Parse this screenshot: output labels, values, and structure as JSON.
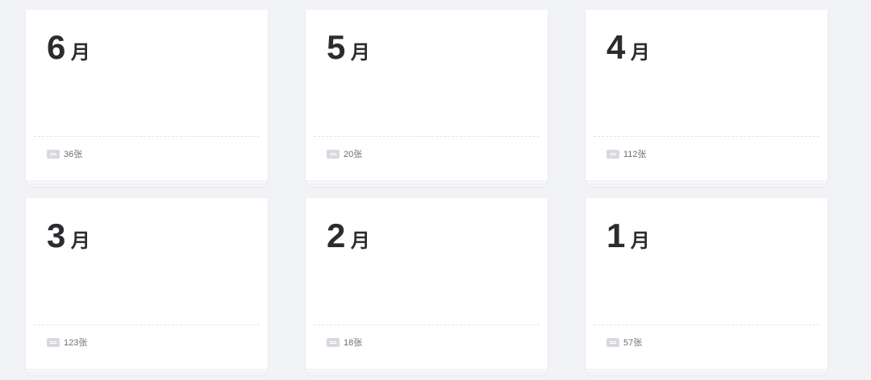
{
  "month_unit": "月",
  "cards": [
    {
      "month": "6",
      "count": "36张"
    },
    {
      "month": "5",
      "count": "20张"
    },
    {
      "month": "4",
      "count": "112张"
    },
    {
      "month": "3",
      "count": "123张"
    },
    {
      "month": "2",
      "count": "18张"
    },
    {
      "month": "1",
      "count": "57张"
    }
  ],
  "colors": {
    "background": "#f2f3f6",
    "card": "#ffffff",
    "text": "#2c2c30",
    "muted": "#6b6d75",
    "icon": "#d8d9e0"
  },
  "icons": {
    "count_icon": "document-icon"
  }
}
